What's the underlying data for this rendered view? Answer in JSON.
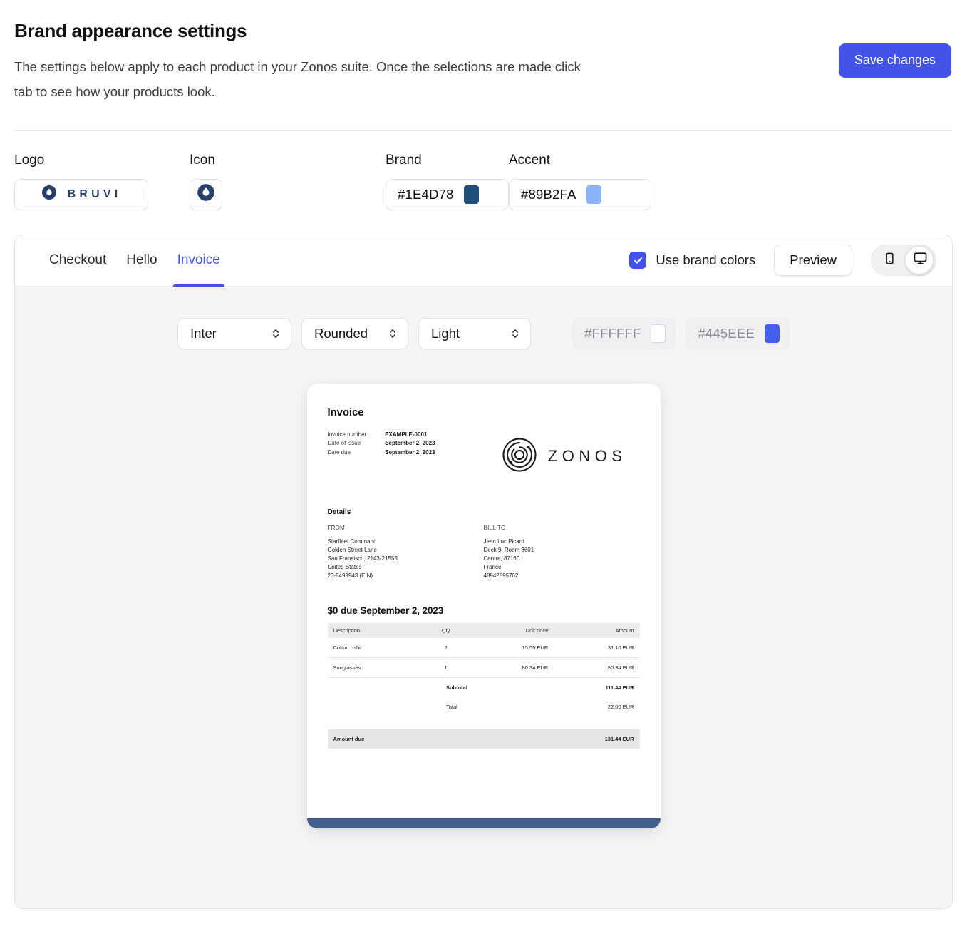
{
  "header": {
    "title": "Brand appearance settings",
    "subtitle": "The settings below apply to each product in your Zonos suite. Once the selections are made click tab to see how your products look.",
    "save_label": "Save changes",
    "save_color": "#4353E8"
  },
  "brand_row": {
    "logo_label": "Logo",
    "logo_wordmark": "BRUVI",
    "icon_label": "Icon",
    "brand_label": "Brand",
    "brand_value": "#1E4D78",
    "accent_label": "Accent",
    "accent_value": "#89B2FA"
  },
  "preview": {
    "tabs": [
      {
        "label": "Checkout",
        "active": false
      },
      {
        "label": "Hello",
        "active": false
      },
      {
        "label": "Invoice",
        "active": true
      }
    ],
    "use_brand_colors_label": "Use brand colors",
    "use_brand_colors_checked": true,
    "preview_button": "Preview",
    "devices": [
      {
        "name": "mobile",
        "selected": false
      },
      {
        "name": "desktop",
        "selected": true
      }
    ],
    "controls": {
      "font": "Inter",
      "corners": "Rounded",
      "theme": "Light",
      "background_color": "#FFFFFF",
      "accent_color": "#445EEE",
      "background_color_disabled": true,
      "accent_color_disabled": true
    }
  },
  "invoice": {
    "title": "Invoice",
    "meta": [
      {
        "key": "Invoice number",
        "value": "EXAMPLE-0001"
      },
      {
        "key": "Date of issue",
        "value": "September 2, 2023"
      },
      {
        "key": "Date due",
        "value": "September 2, 2023"
      }
    ],
    "brand_wordmark": "ZONOS",
    "details_heading": "Details",
    "from_heading": "FROM",
    "from_lines": [
      "Starfleet Command",
      "Golden Street Lane",
      "San Fransisco, 2143-21555",
      "United States",
      "23-8493943 (EIN)"
    ],
    "bill_to_heading": "BILL TO",
    "bill_to_lines": [
      "Jean Luc Picard",
      "Deck 9, Room 3601",
      "Centre, 87160",
      "France",
      "48942895762"
    ],
    "due_heading": "$0 due September 2, 2023",
    "table": {
      "columns": [
        "Description",
        "Qty",
        "Unit price",
        "Amount"
      ],
      "rows": [
        {
          "description": "Cotton t-shirt",
          "qty": "2",
          "unit_price": "15.55 EUR",
          "amount": "31.10 EUR"
        },
        {
          "description": "Sunglasses",
          "qty": "1",
          "unit_price": "80.34 EUR",
          "amount": "80.34 EUR"
        }
      ],
      "totals": [
        {
          "label": "Subtotal",
          "value": "111.44 EUR",
          "bold": true
        },
        {
          "label": "Total",
          "value": "22.00 EUR",
          "bold": false
        }
      ],
      "amount_due_label": "Amount due",
      "amount_due_value": "131.44 EUR"
    },
    "footer_bar_color": "#44608A"
  }
}
